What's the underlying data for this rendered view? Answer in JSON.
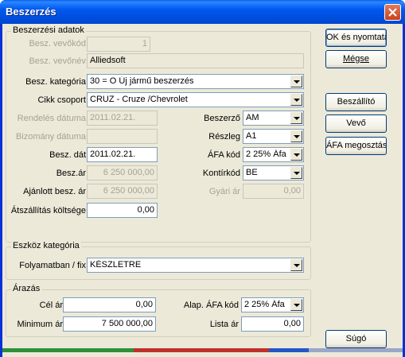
{
  "window": {
    "title": "Beszerzés"
  },
  "groups": {
    "beszerzesi": "Beszerzési adatok",
    "eszkoz": "Eszköz kategória",
    "arazas": "Árazás"
  },
  "fields": {
    "vevokod": {
      "label": "Besz. vevőkód",
      "value": "1"
    },
    "vevonev": {
      "label": "Besz. vevőnév",
      "value": "Alliedsoft"
    },
    "kategoria": {
      "label": "Besz. kategória",
      "value": "30 = O Új jármű beszerzés"
    },
    "cikkcsoport": {
      "label": "Cikk csoport",
      "value": "CRUZ - Cruze /Chevrolet"
    },
    "rendeles": {
      "label": "Rendelés dátuma",
      "value": "2011.02.21."
    },
    "bizomany": {
      "label": "Bizomány dátuma",
      "value": ""
    },
    "beszdat": {
      "label": "Besz. dát",
      "value": "2011.02.21."
    },
    "beszar": {
      "label": "Besz.ár",
      "value": "6 250 000,00"
    },
    "ajanlott": {
      "label": "Ajánlott besz. ár",
      "value": "6 250 000,00"
    },
    "atszallitas": {
      "label": "Átszállítás költsége",
      "value": "0,00"
    },
    "beszerzo": {
      "label": "Beszerző",
      "value": "AM"
    },
    "reszleg": {
      "label": "Részleg",
      "value": "A1"
    },
    "afakod": {
      "label": "ÁFA kód",
      "value": "2 25% Áfa"
    },
    "kontirkod": {
      "label": "Kontírkód",
      "value": "BE"
    },
    "gyariar": {
      "label": "Gyári ár",
      "value": "0,00"
    },
    "folyamatban": {
      "label": "Folyamatban / fix",
      "value": "KÉSZLETRE"
    },
    "celar": {
      "label": "Cél ár",
      "value": "0,00"
    },
    "minimumar": {
      "label": "Minimum ár",
      "value": "7 500 000,00"
    },
    "alapafa": {
      "label": "Alap. ÁFA kód",
      "value": "2 25% Áfa"
    },
    "listaar": {
      "label": "Lista ár",
      "value": "0,00"
    }
  },
  "buttons": {
    "ok_print": "OK és nyomtatás",
    "megse": "Mégse",
    "beszallito": "Beszállító",
    "vevo": "Vevő",
    "afa_megosztas": "ÁFA megosztás",
    "sugo": "Súgó"
  },
  "colors": {
    "title_bar": "#0058ee",
    "dialog_bg": "#ece9d8",
    "disabled_text": "#a6a395"
  }
}
